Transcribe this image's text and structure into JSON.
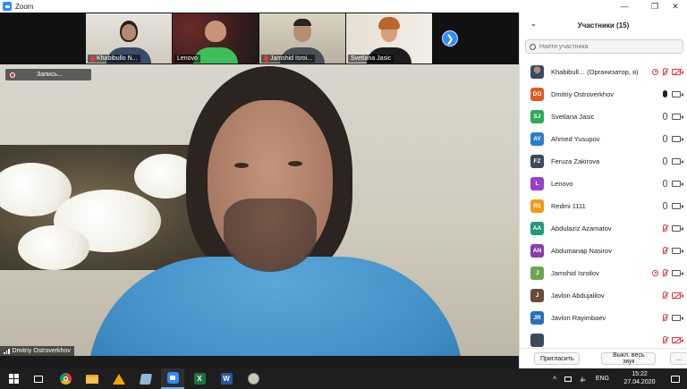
{
  "window": {
    "title": "Zoom"
  },
  "recording": {
    "label": "Запись..."
  },
  "gallery": [
    {
      "name": "Khabibullo N...",
      "muted": true
    },
    {
      "name": "Lenovo",
      "muted": false
    },
    {
      "name": "Jamshid Isroi...",
      "muted": true
    },
    {
      "name": "Svetlana Jasic",
      "muted": false
    }
  ],
  "active_speaker": {
    "name": "Dmitriy Ostroverkhov"
  },
  "panel": {
    "title": "Участники (15)",
    "search_placeholder": "Найти участника",
    "participants": [
      {
        "initials": "",
        "name": "Khabibull...",
        "role": "(Организатор, я)",
        "color": "#8a8a6a",
        "photo": true,
        "rec": true,
        "mic": "red",
        "cam": "red"
      },
      {
        "initials": "DO",
        "name": "Dmitriy Ostroverkhov",
        "color": "#e05a2a",
        "mic": "black",
        "cam": "normal"
      },
      {
        "initials": "SJ",
        "name": "Svetlana Jasic",
        "color": "#2faa5a",
        "mic": "normal",
        "cam": "normal"
      },
      {
        "initials": "AY",
        "name": "Ahmed Yusupov",
        "color": "#2a7fc9",
        "mic": "normal",
        "cam": "normal"
      },
      {
        "initials": "FZ",
        "name": "Feruza Zakirova",
        "color": "#3c4a5a",
        "mic": "normal",
        "cam": "normal"
      },
      {
        "initials": "L",
        "name": "Lenovo",
        "color": "#9b3fc8",
        "mic": "normal",
        "cam": "normal"
      },
      {
        "initials": "R1",
        "name": "Redmi 1111",
        "color": "#f29a1c",
        "mic": "normal",
        "cam": "normal"
      },
      {
        "initials": "AA",
        "name": "Abdulaziz Azamatov",
        "color": "#1f9a7a",
        "mic": "red",
        "cam": "normal"
      },
      {
        "initials": "AN",
        "name": "Abdumanap Nasirov",
        "color": "#8a3fa8",
        "mic": "red",
        "cam": "normal"
      },
      {
        "initials": "J",
        "name": "Jamshid Isroilov",
        "color": "#6aa84f",
        "rec": true,
        "mic": "red",
        "cam": "normal"
      },
      {
        "initials": "J",
        "name": "Javlon Abdujalilov",
        "color": "#6b4a3a",
        "mic": "red",
        "cam": "red"
      },
      {
        "initials": "JR",
        "name": "Javlon Rayimbaev",
        "color": "#2a6fba",
        "mic": "red",
        "cam": "normal"
      },
      {
        "initials": "",
        "name": "",
        "color": "#3c4a5a",
        "mic": "red",
        "cam": "red"
      }
    ],
    "footer": {
      "invite": "Пригласить",
      "mute_all": "Выкл. весь звук",
      "more": "..."
    }
  },
  "taskbar": {
    "language": "ENG",
    "time": "15:22",
    "date": "27.04.2020"
  }
}
